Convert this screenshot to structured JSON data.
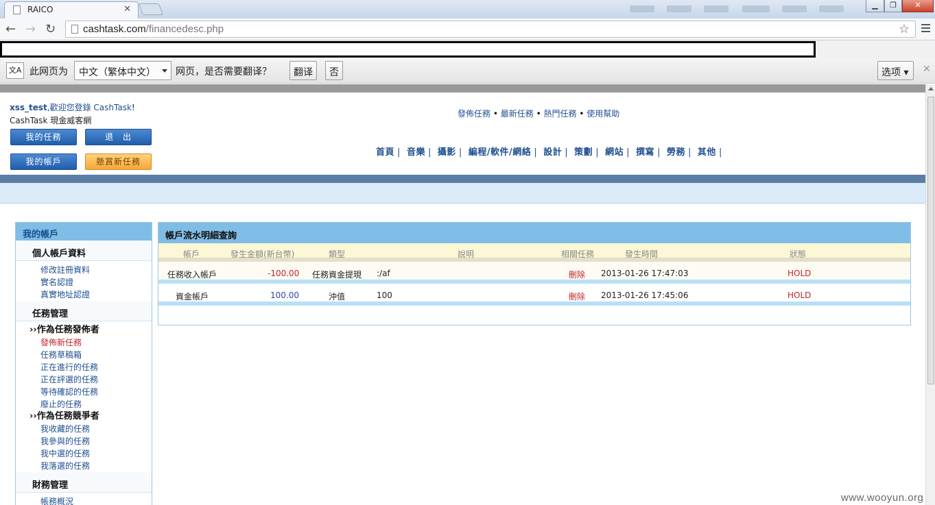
{
  "browser": {
    "tab_title": "RAICO",
    "url_domain": "cashtask.com",
    "url_path": "/financedesc.php"
  },
  "translate_bar": {
    "prefix": "此网页为",
    "language": "中文（繁体中文）",
    "suffix": "网页，是否需要翻译？",
    "translate_btn": "翻译",
    "no_btn": "否",
    "options_btn": "选项"
  },
  "header": {
    "user": "xss_test",
    "welcome": ",歡迎您登錄 ",
    "site_short": "CashTask",
    "exclaim": "!",
    "site_full": "CashTask 現金威客網",
    "btn_my_tasks": "我的任務",
    "btn_logout": "退　出",
    "btn_my_account": "我的帳戶",
    "btn_new_task": "懸賞新任務",
    "top_links": [
      "發佈任務",
      "最新任務",
      "熱門任務",
      "使用幫助"
    ],
    "nav": [
      "首頁",
      "音樂",
      "攝影",
      "編程/軟件/網絡",
      "設計",
      "策劃",
      "網站",
      "撰寫",
      "勞務",
      "其他"
    ]
  },
  "sidebar": {
    "title": "我的帳戶",
    "sec_profile": "個人帳戶資料",
    "profile_links": [
      "修改註冊資料",
      "實名認證",
      "真實地址認證"
    ],
    "sec_tasks": "任務管理",
    "sub_publisher": "››作為任務發佈者",
    "publisher_links": [
      "發佈新任務",
      "任務草稿箱",
      "正在進行的任務",
      "正在評選的任務",
      "等待確認的任務",
      "廢止的任務"
    ],
    "sub_competitor": "››作為任務競爭者",
    "competitor_links": [
      "我收藏的任務",
      "我參與的任務",
      "我中選的任務",
      "我落選的任務"
    ],
    "sec_finance": "財務管理",
    "finance_links": [
      "帳務概況"
    ]
  },
  "content": {
    "title": "帳戶流水明細查詢",
    "columns": [
      "帳戶",
      "發生金額(新台幣)",
      "類型",
      "說明",
      "相關任務",
      "發生時間",
      "狀態"
    ],
    "rows": [
      {
        "account": "任務收入帳戶",
        "amount": "-100.00",
        "type": "任務資金提現",
        "desc": ":/af",
        "task": "刪除",
        "time": "2013-01-26 17:47:03",
        "status": "HOLD"
      },
      {
        "account": "資金帳戶",
        "amount": "100.00",
        "type": "沖值",
        "desc": "100",
        "task": "刪除",
        "time": "2013-01-26 17:45:06",
        "status": "HOLD"
      }
    ]
  },
  "watermark": "www.wooyun.org",
  "colors": {
    "panel_header": "#7fbde6",
    "link_blue": "#1f4f8f",
    "accent_red": "#c0262b",
    "table_header_bg": "#fcf7d6"
  }
}
